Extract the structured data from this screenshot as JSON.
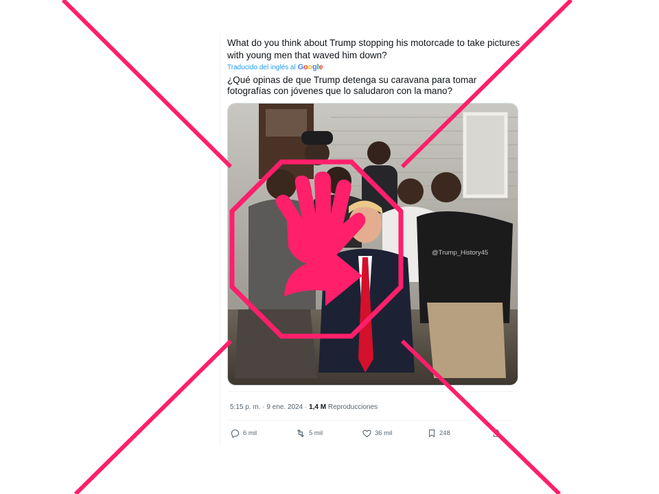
{
  "tweet": {
    "text": "What do you think about Trump stopping his motorcade to take pictures with young men that waved him down?",
    "translation_label": "Traducido del inglés al",
    "google_logo": "Google",
    "translated_text": "¿Qué opinas de que Trump detenga su caravana para tomar fotografías con jóvenes que lo saludaron con la mano?",
    "image_watermark": "@Trump_History45",
    "timestamp": "5:15 p. m. · 9 ene. 2024 · ",
    "views_count": "1,4 M",
    "views_label": " Reproducciones",
    "actions": {
      "replies": "6 mil",
      "retweets": "5 mil",
      "likes": "36 mil",
      "bookmarks": "248"
    }
  },
  "colors": {
    "overlay_pink": "#ff1f6b",
    "link_blue": "#1d9bf0",
    "muted_text": "#536471"
  },
  "icons": {
    "overlay_symbol": "stop-hand-icon",
    "reply": "reply-icon",
    "retweet": "retweet-icon",
    "like": "heart-icon",
    "bookmark": "bookmark-icon",
    "share": "share-icon"
  }
}
